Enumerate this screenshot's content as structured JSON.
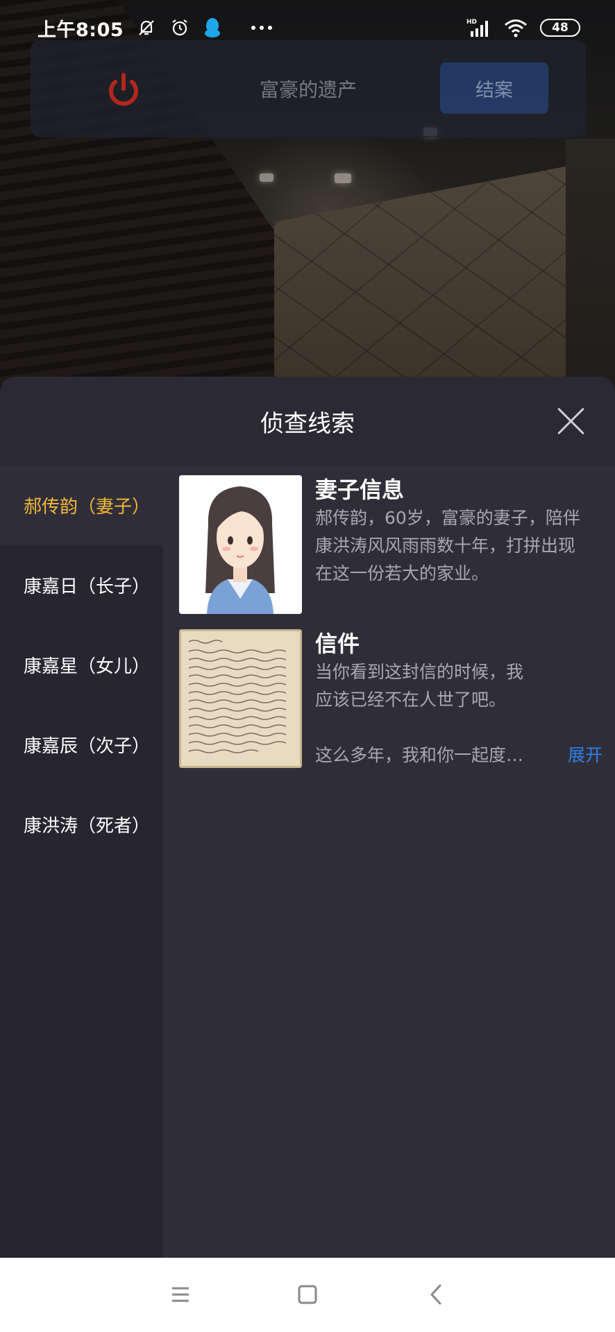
{
  "status_bar": {
    "time": "上午8:05",
    "icons": [
      "bell-off-icon",
      "alarm-icon",
      "qq-penguin-icon",
      "more-dots-icon",
      "hd-signal-icon",
      "wifi-icon"
    ],
    "battery": "48"
  },
  "top_bar": {
    "case_title": "富豪的遗产",
    "close_case_label": "结案",
    "power_color": "#b3261e"
  },
  "panel": {
    "title": "侦查线索",
    "sidebar": {
      "items": [
        {
          "label": "郝传韵（妻子）",
          "active": true
        },
        {
          "label": "康嘉日（长子）",
          "active": false
        },
        {
          "label": "康嘉星（女儿）",
          "active": false
        },
        {
          "label": "康嘉辰（次子）",
          "active": false
        },
        {
          "label": "康洪涛（死者）",
          "active": false
        }
      ]
    },
    "clues": [
      {
        "title": "妻子信息",
        "lines": [
          "郝传韵，60岁，富豪的妻子，陪伴",
          "康洪涛风风雨雨数十年，打拼出现",
          "在这一份若大的家业。"
        ]
      },
      {
        "title": "信件",
        "lines": [
          "当你看到这封信的时候，我",
          "应该已经不在人世了吧。",
          "这么多年，我和你一起度…"
        ],
        "expand_label": "展开"
      }
    ]
  },
  "colors": {
    "active_accent": "#f2b63a",
    "link_blue": "#2f80e8",
    "panel_bg": "#27262f",
    "content_bg": "#2f2e38"
  }
}
